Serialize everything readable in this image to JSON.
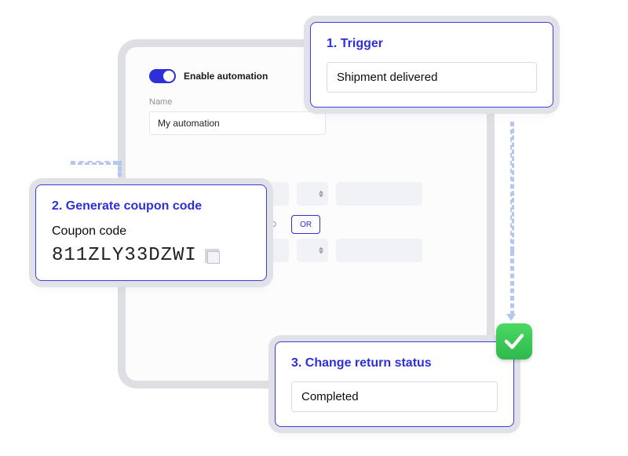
{
  "panel": {
    "toggle_label": "Enable automation",
    "name_label": "Name",
    "name_value": "My automation",
    "logic": {
      "and": "AND",
      "or": "OR",
      "active": "or"
    }
  },
  "cards": {
    "trigger": {
      "title": "1. Trigger",
      "value": "Shipment delivered"
    },
    "coupon": {
      "title": "2. Generate coupon code",
      "sublabel": "Coupon code",
      "code": "811ZLY33DZWI"
    },
    "status": {
      "title": "3. Change return status",
      "value": "Completed"
    }
  }
}
